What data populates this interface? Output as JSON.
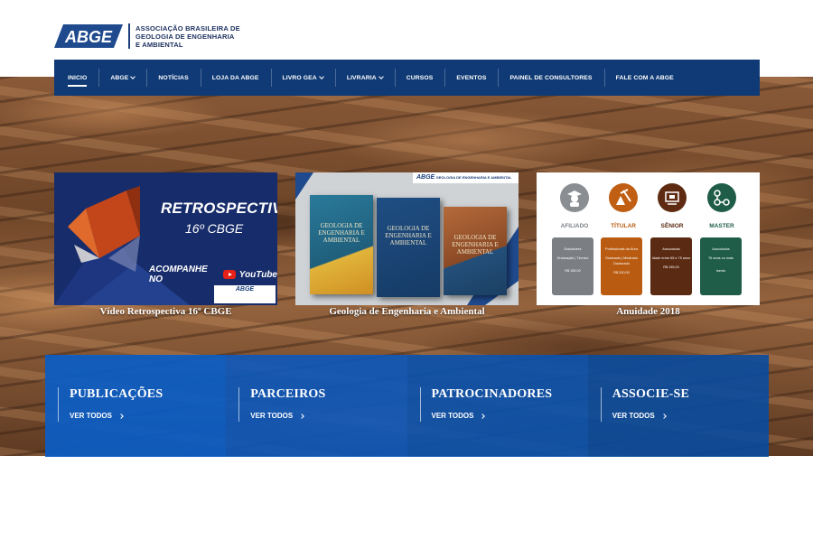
{
  "logo": {
    "mark": "ABGE",
    "line1": "ASSOCIAÇÃO BRASILEIRA DE",
    "line2": "GEOLOGIA DE ENGENHARIA",
    "line3": "E AMBIENTAL"
  },
  "nav": {
    "items": [
      {
        "label": "INICIO"
      },
      {
        "label": "ABGE"
      },
      {
        "label": "NOTÍCIAS"
      },
      {
        "label": "LOJA DA ABGE"
      },
      {
        "label": "LIVRO GEA"
      },
      {
        "label": "LIVRARIA"
      },
      {
        "label": "CURSOS"
      },
      {
        "label": "EVENTOS"
      },
      {
        "label": "PAINEL DE CONSULTORES"
      },
      {
        "label": "FALE COM A ABGE"
      }
    ]
  },
  "cards": {
    "retro": {
      "title": "RETROSPECTIVA",
      "subtitle": "16º CBGE",
      "cta": "ACOMPANHE NO",
      "yt": "YouTube",
      "badge": "ABGE",
      "caption": "Vídeo Retrospectiva 16º CBGE"
    },
    "book": {
      "banner_mark": "ABGE",
      "banner_text": "GEOLOGIA DE ENGENHARIA E AMBIENTAL",
      "book_title": "GEOLOGIA DE ENGENHARIA E AMBIENTAL",
      "caption": "Geologia de Engenharia e Ambiental"
    },
    "anuidade": {
      "tiers": [
        {
          "name": "AFILIADO",
          "box1": "Estudantes",
          "box2": "Graduação | Técnico",
          "price": "R$ 155,00",
          "color": "#7b7f84"
        },
        {
          "name": "TÍTULAR",
          "box1": "Profissionais da Área",
          "box2": "Graduado | Mestrado Doutorado",
          "price": "R$ 310,00",
          "color": "#b95c12"
        },
        {
          "name": "SÊNIOR",
          "box1": "Associados",
          "box2": "Idade entre 65 e 75 anos",
          "price": "R$ 155,00",
          "color": "#5b2a12"
        },
        {
          "name": "MASTER",
          "box1": "Associados",
          "box2": "76 anos ou mais",
          "price": "Isento",
          "color": "#1f5d49"
        }
      ],
      "caption": "Anuidade 2018"
    }
  },
  "band": {
    "items": [
      {
        "title": "PUBLICAÇÕES",
        "link": "VER TODOS",
        "color": "#0b5cc4"
      },
      {
        "title": "PARCEIROS",
        "link": "VER TODOS",
        "color": "#0c58bb"
      },
      {
        "title": "PATROCINADORES",
        "link": "VER TODOS",
        "color": "#0a52ae"
      },
      {
        "title": "ASSOCIE-SE",
        "link": "VER TODOS",
        "color": "#094b9f"
      }
    ]
  }
}
